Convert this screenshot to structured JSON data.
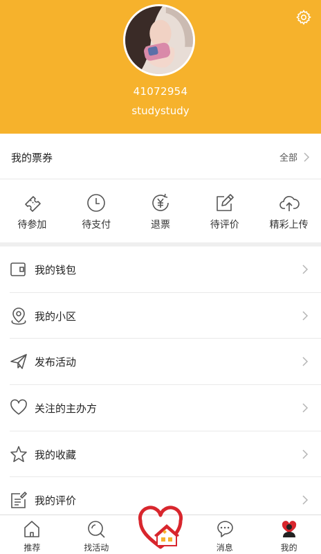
{
  "colors": {
    "brand": "#f6b22c",
    "icon": "#555555",
    "chevron": "#b5b5b5",
    "heart": "#d8262d"
  },
  "profile": {
    "user_id": "41072954",
    "username": "studystudy"
  },
  "tickets": {
    "title": "我的票券",
    "all_label": "全部"
  },
  "status_items": [
    {
      "label": "待参加",
      "icon": "ticket-icon"
    },
    {
      "label": "待支付",
      "icon": "clock-icon"
    },
    {
      "label": "退票",
      "icon": "refund-yen-icon"
    },
    {
      "label": "待评价",
      "icon": "edit-icon"
    },
    {
      "label": "精彩上传",
      "icon": "cloud-upload-icon"
    }
  ],
  "menu": [
    {
      "label": "我的钱包",
      "icon": "wallet-icon"
    },
    {
      "label": "我的小区",
      "icon": "location-pin-icon"
    },
    {
      "label": "发布活动",
      "icon": "paper-plane-icon"
    },
    {
      "label": "关注的主办方",
      "icon": "heart-icon"
    },
    {
      "label": "我的收藏",
      "icon": "star-icon"
    },
    {
      "label": "我的评价",
      "icon": "review-icon"
    }
  ],
  "tabs": [
    {
      "label": "推荐",
      "icon": "home-icon"
    },
    {
      "label": "找活动",
      "icon": "search-icon"
    },
    {
      "label": "",
      "icon": "heart-house-logo-icon"
    },
    {
      "label": "消息",
      "icon": "chat-bubble-icon"
    },
    {
      "label": "我的",
      "icon": "profile-icon"
    }
  ]
}
